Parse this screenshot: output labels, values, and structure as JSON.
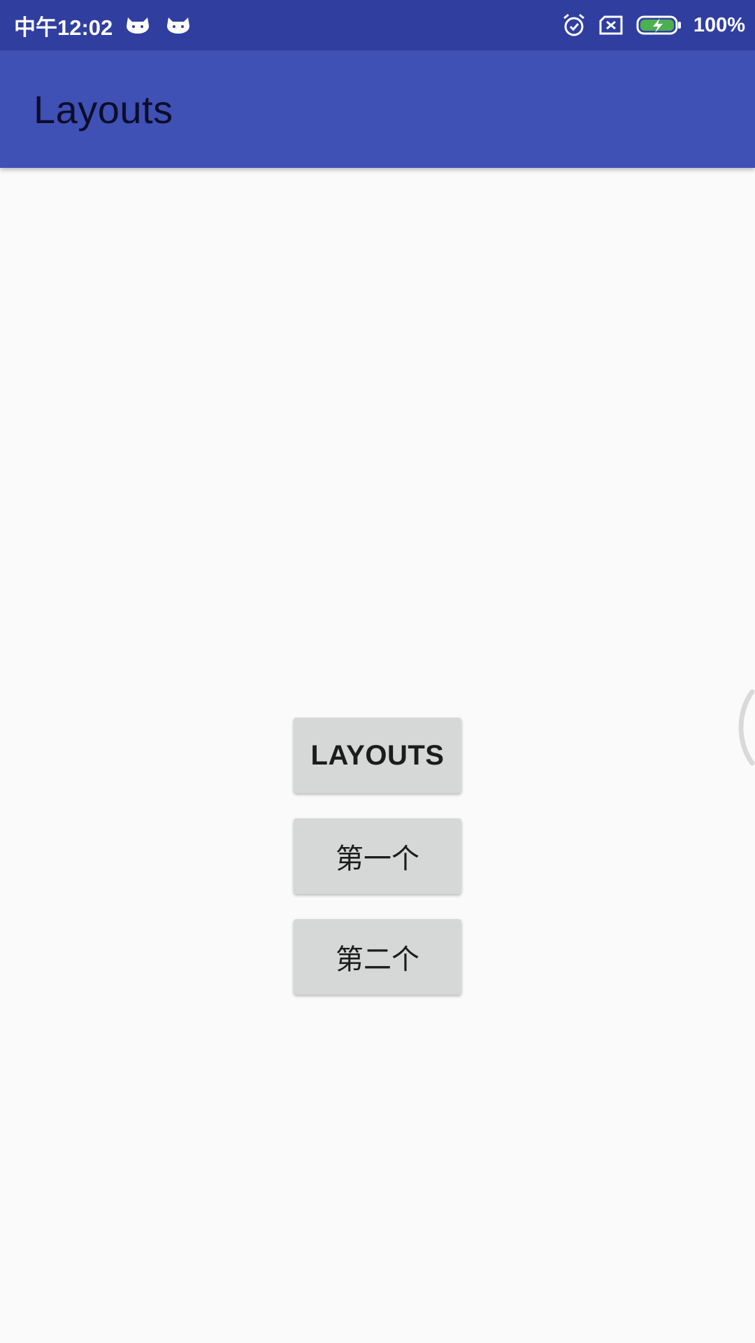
{
  "status_bar": {
    "time": "中午12:02",
    "battery_percent": "100%",
    "left_icons": [
      "cat-notification-icon",
      "cat-notification-icon"
    ],
    "right_icons": [
      "alarm-icon",
      "no-sim-icon",
      "battery-charging-icon"
    ],
    "battery_color": "#4caf50"
  },
  "app_bar": {
    "title": "Layouts",
    "color": "#3f51b5"
  },
  "buttons": [
    {
      "label": "LAYOUTS"
    },
    {
      "label": "第一个"
    },
    {
      "label": "第二个"
    }
  ]
}
